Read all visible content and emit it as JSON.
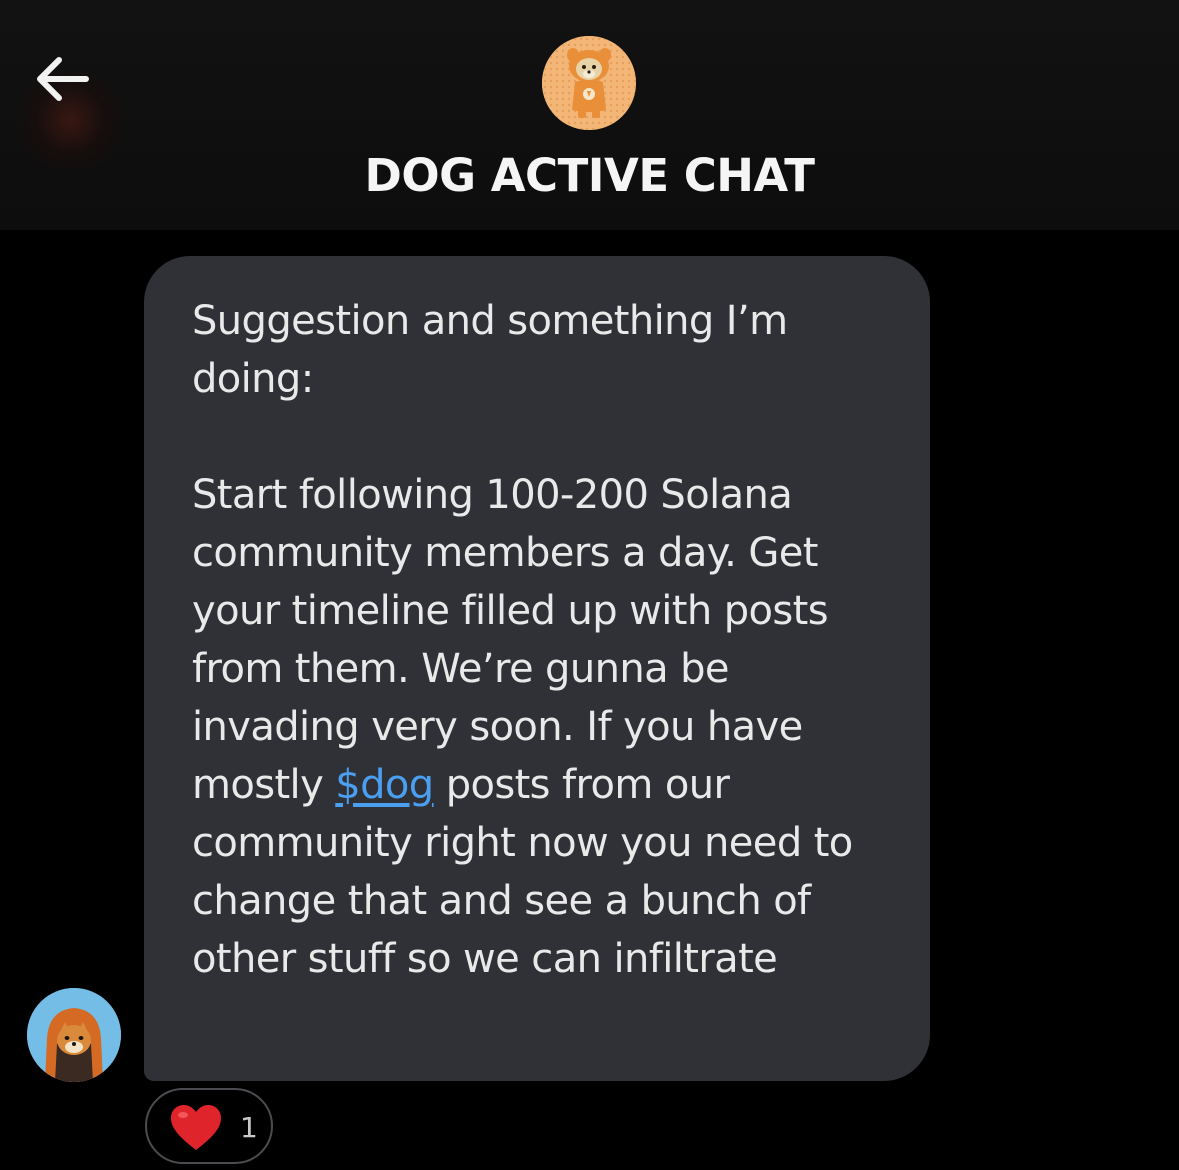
{
  "header": {
    "back_icon": "arrow-left-icon",
    "group_avatar_icon": "dog-avatar-icon",
    "title": "DOG ACTIVE CHAT"
  },
  "message": {
    "sender_avatar_icon": "shiba-ninja-avatar-icon",
    "paragraph1": "Suggestion and something I’m doing:",
    "paragraph2_before_link": "Start following 100-200 Solana community members a day. Get your timeline filled up with posts from them. We’re gunna be invading very soon. If you have mostly ",
    "link_text": "$dog",
    "paragraph2_after_link": " posts from our community right now you need to change that and see a bunch of other stuff so we can infiltrate",
    "reaction": {
      "emoji": "red-heart-icon",
      "count": "1"
    }
  },
  "colors": {
    "background": "#000000",
    "bubble": "#2f3136",
    "text": "#e9e9ea",
    "link": "#4b9ff0",
    "heart": "#e0242b"
  }
}
